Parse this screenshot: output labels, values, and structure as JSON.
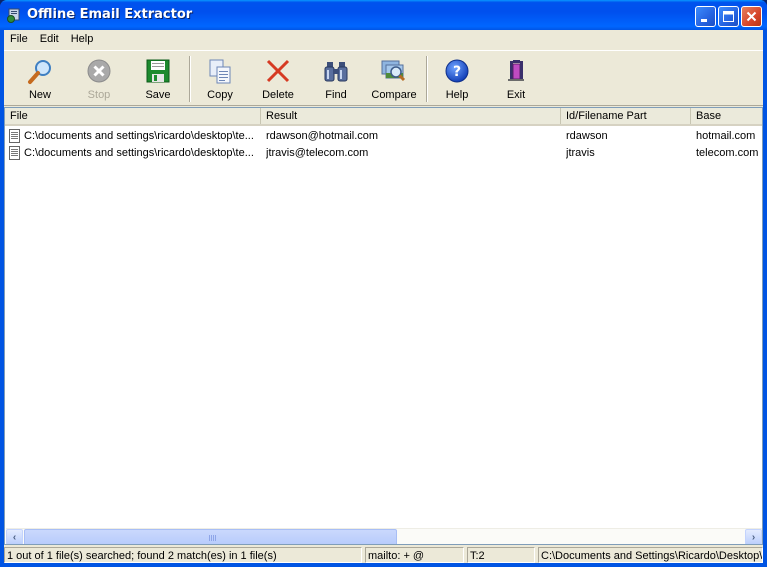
{
  "window": {
    "title": "Offline Email Extractor",
    "controls": {
      "minimize": "minimize",
      "maximize": "maximize",
      "close": "close"
    }
  },
  "menu": [
    {
      "label": "File"
    },
    {
      "label": "Edit"
    },
    {
      "label": "Help"
    }
  ],
  "toolbar": {
    "buttons": [
      {
        "label": "New",
        "icon": "magnifier-icon",
        "enabled": true
      },
      {
        "label": "Stop",
        "icon": "stop-icon",
        "enabled": false
      },
      {
        "label": "Save",
        "icon": "floppy-disk-icon",
        "enabled": true
      },
      {
        "label": "Copy",
        "icon": "copy-icon",
        "enabled": true
      },
      {
        "label": "Delete",
        "icon": "delete-x-icon",
        "enabled": true
      },
      {
        "label": "Find",
        "icon": "binoculars-icon",
        "enabled": true
      },
      {
        "label": "Compare",
        "icon": "compare-icon",
        "enabled": true
      },
      {
        "label": "Help",
        "icon": "help-icon",
        "enabled": true
      },
      {
        "label": "Exit",
        "icon": "exit-door-icon",
        "enabled": true
      }
    ]
  },
  "results": {
    "columns": [
      "File",
      "Result",
      "Id/Filename Part",
      "Base"
    ],
    "rows": [
      {
        "file": "C:\\documents and settings\\ricardo\\desktop\\te...",
        "result": "rdawson@hotmail.com",
        "id": "rdawson",
        "base": "hotmail.com"
      },
      {
        "file": "C:\\documents and settings\\ricardo\\desktop\\te...",
        "result": "jtravis@telecom.com",
        "id": "jtravis",
        "base": "telecom.com"
      }
    ]
  },
  "statusbar": {
    "summary": "1 out of 1 file(s) searched; found 2 match(es) in 1 file(s)",
    "filter": "mailto: + @",
    "threads": "T:2",
    "path": "C:\\Documents and Settings\\Ricardo\\Desktop\\T"
  },
  "colors": {
    "titlebar": "#0054e3",
    "face": "#ece9d8",
    "close_button": "#d6452a"
  }
}
